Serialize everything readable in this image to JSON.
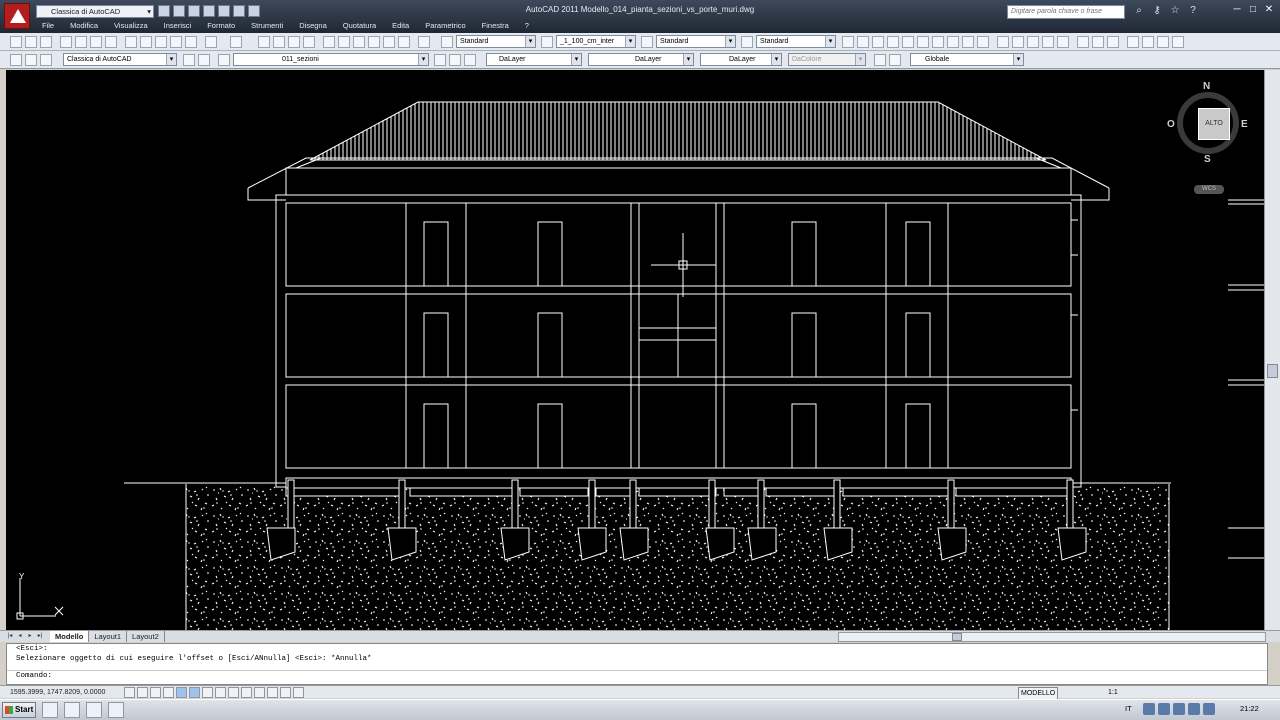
{
  "titlebar": {
    "workspace": "Classica di AutoCAD",
    "title": "AutoCAD 2011    Modello_014_pianta_sezioni_vs_porte_muri.dwg",
    "search_placeholder": "Digitare parola chiave o frase",
    "window_buttons": [
      "─",
      "□",
      "✕"
    ]
  },
  "menu": [
    "File",
    "Modifica",
    "Visualizza",
    "Inserisci",
    "Formato",
    "Strumenti",
    "Disegna",
    "Quotatura",
    "Edita",
    "Parametrico",
    "Finestra",
    "?"
  ],
  "toolbar1": {
    "text_style": "Standard",
    "dim_style": "_1_100_cm_inter",
    "table_style": "Standard",
    "multileader_style": "Standard"
  },
  "toolbar2": {
    "workspace": "Classica di AutoCAD",
    "layer": "011_sezioni",
    "color": "DaLayer",
    "linetype": "DaLayer",
    "lineweight": "DaLayer",
    "plotstyle": "DaColore",
    "ucs": "Globale"
  },
  "viewcube": {
    "face": "ALTO",
    "north": "N",
    "south": "S",
    "east": "E",
    "west": "O",
    "wcs": "WCS"
  },
  "ucs_icon": {
    "x_label": "X",
    "y_label": "Y"
  },
  "layout_tabs": [
    "Modello",
    "Layout1",
    "Layout2"
  ],
  "tab_nav": [
    "|◂",
    "◂",
    "▸",
    "▸|"
  ],
  "command": {
    "history_1": "<Esci>:",
    "history_2": "Selezionare oggetto di cui eseguire l'offset o [Esci/ANnulla] <Esci>: *Annulla*",
    "prompt": "Comando:"
  },
  "status": {
    "coordinates": "1595.3999, 1747.8209, 0.0000",
    "model": "MODELLO",
    "annotation_scale": "1:1"
  },
  "taskbar": {
    "start": "Start",
    "language": "IT",
    "clock": "21:22"
  }
}
